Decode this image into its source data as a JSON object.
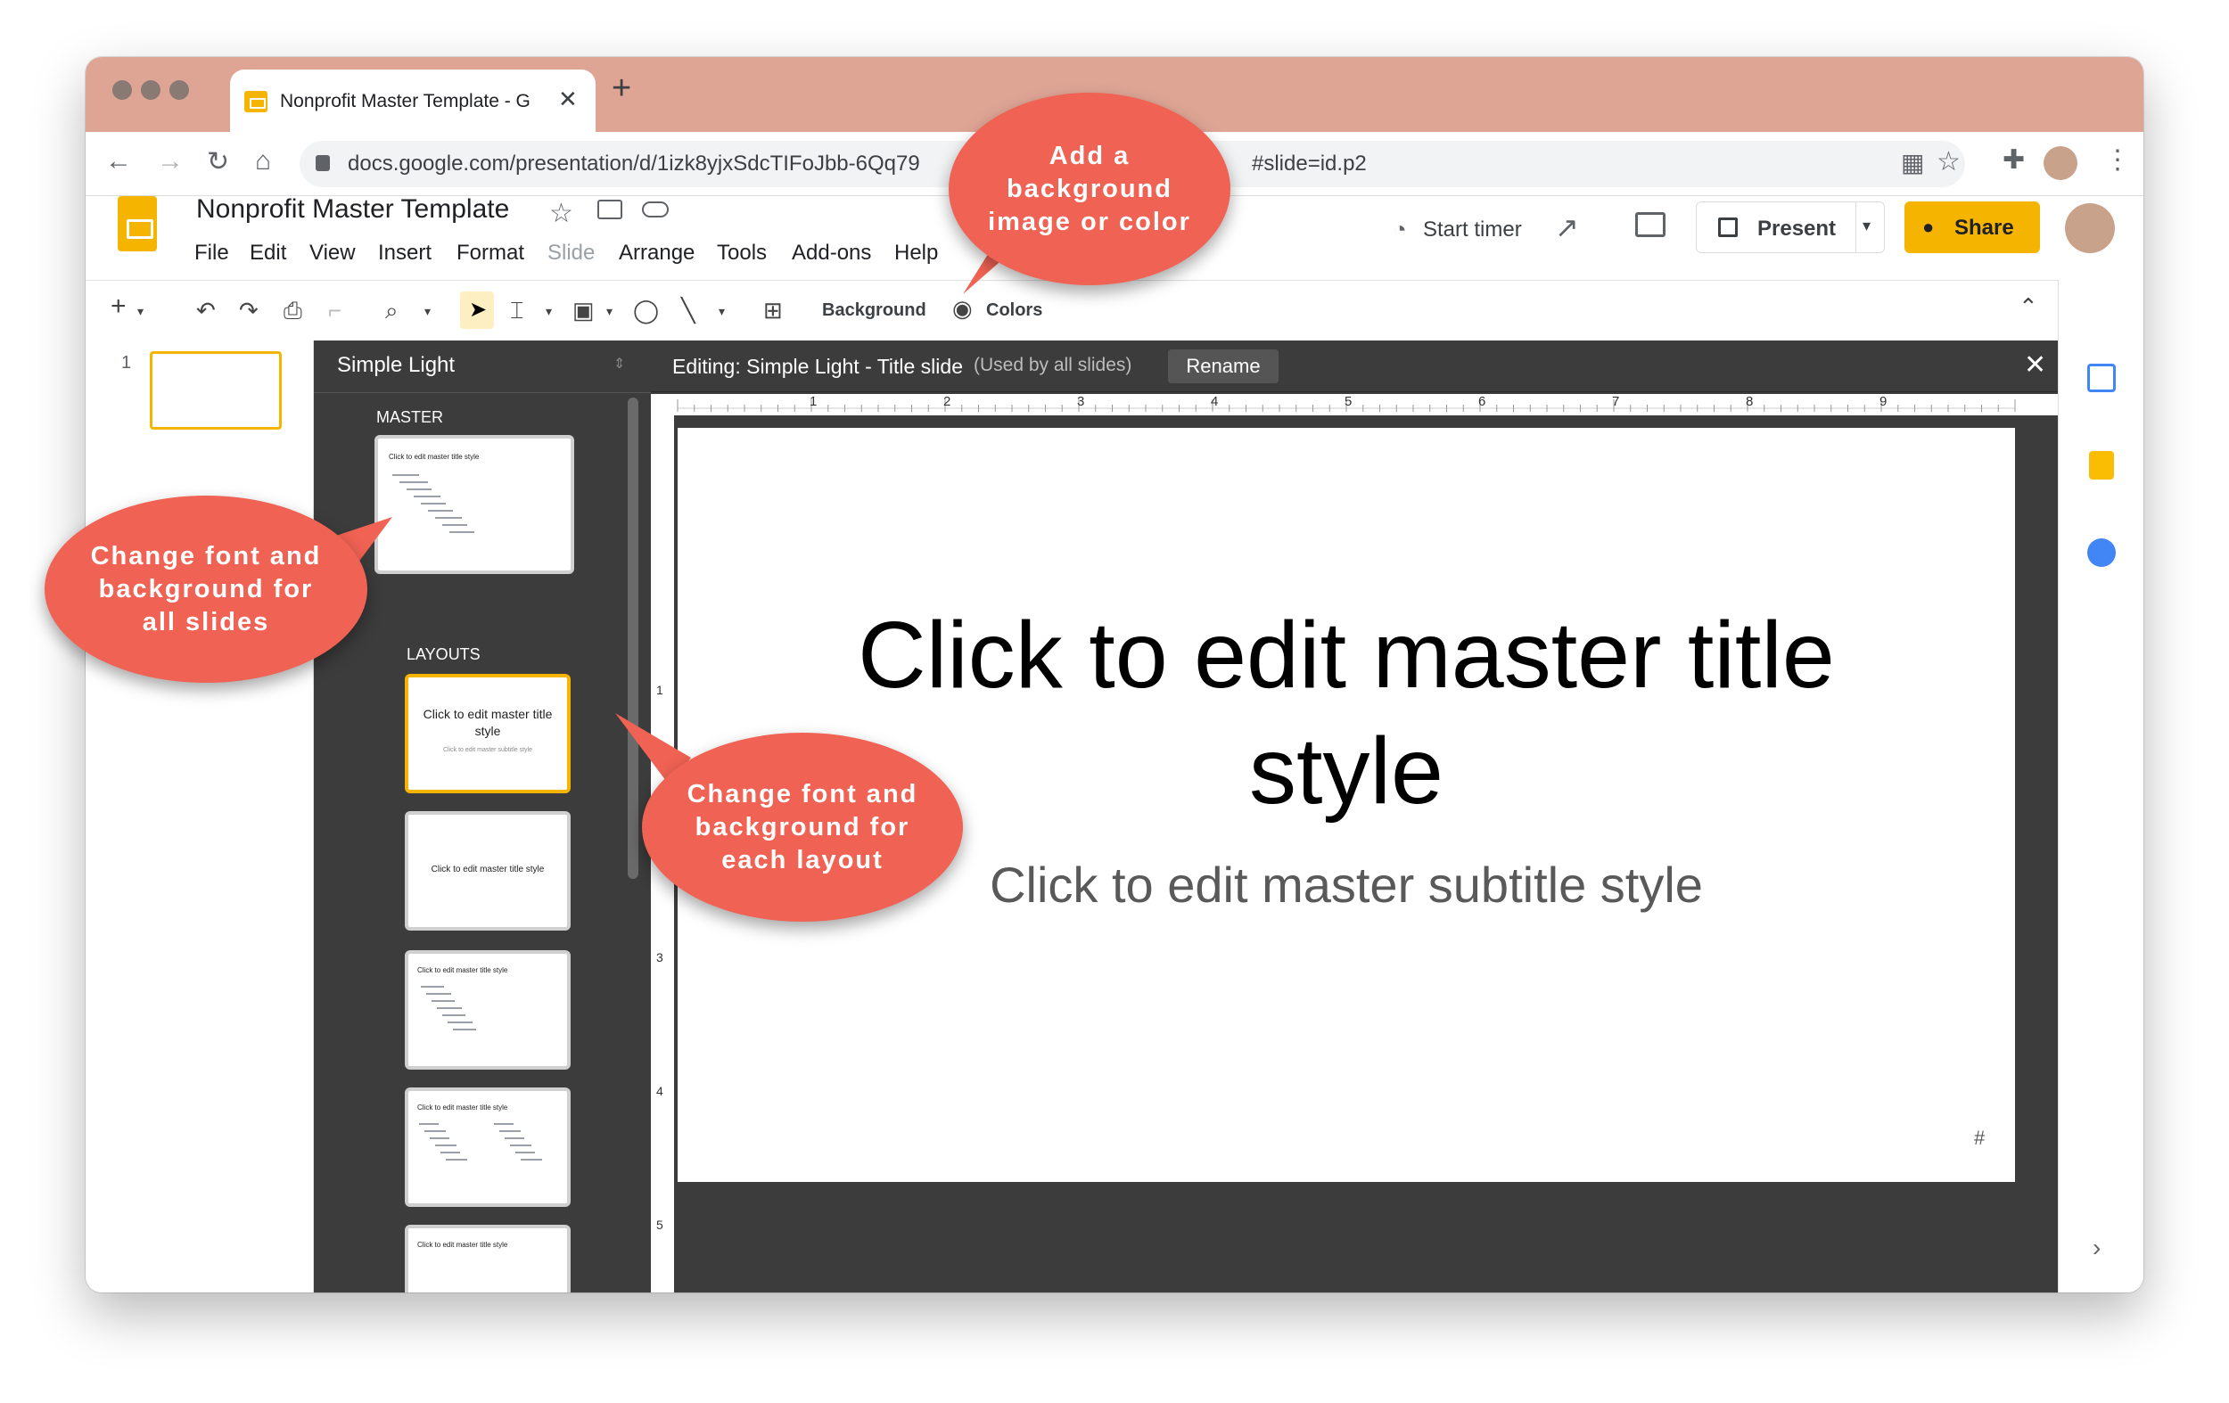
{
  "browser": {
    "tab_title": "Nonprofit Master Template - G",
    "url_visible": "docs.google.com/presentation/d/1izk8yjxSdcTIFoJbb-6Qq79",
    "url_tail": "#slide=id.p2"
  },
  "app": {
    "doc_title": "Nonprofit Master Template",
    "menus": [
      "File",
      "Edit",
      "View",
      "Insert",
      "Format",
      "Slide",
      "Arrange",
      "Tools",
      "Add-ons",
      "Help"
    ],
    "start_timer": "Start timer",
    "present": "Present",
    "share": "Share"
  },
  "toolbar": {
    "background": "Background",
    "colors": "Colors"
  },
  "filmstrip": {
    "slide_number": "1"
  },
  "theme_panel": {
    "theme_name": "Simple Light",
    "master_label": "MASTER",
    "layouts_label": "LAYOUTS",
    "master_thumb_title": "Click to edit master title style",
    "master_thumb_bullets": [
      "First level",
      "Second level",
      "Third level",
      "Fourth level",
      "Fifth level",
      "Sixth level",
      "Seventh level",
      "Eighth level",
      "Ninth level"
    ],
    "layout1_title": "Click to edit master title style",
    "layout1_subtitle": "Click to edit master subtitle style",
    "layout2_title": "Click to edit master title style",
    "layout3_title": "Click to edit master title style",
    "layout4_title": "Click to edit master title style",
    "layout5_title": "Click to edit master title style"
  },
  "editor": {
    "editing_label": "Editing: Simple Light - Title slide",
    "used_by": "(Used by all slides)",
    "rename": "Rename",
    "ruler_numbers": [
      "1",
      "2",
      "3",
      "4",
      "5",
      "6",
      "7",
      "8",
      "9"
    ],
    "vruler_numbers": [
      "1",
      "3",
      "4",
      "5"
    ]
  },
  "slide": {
    "title_line1": "Click to edit master title",
    "title_line2": "style",
    "subtitle": "Click to edit master subtitle style",
    "page_number": "#"
  },
  "callouts": {
    "background": "Add a background image or color",
    "all_slides": "Change font and background for all slides",
    "each_layout": "Change font and background for each layout"
  },
  "colors": {
    "tabbar": "#dea595",
    "accent_yellow": "#f4b400",
    "callout_red": "#f06253",
    "dark_panel": "#3c3c3c"
  }
}
